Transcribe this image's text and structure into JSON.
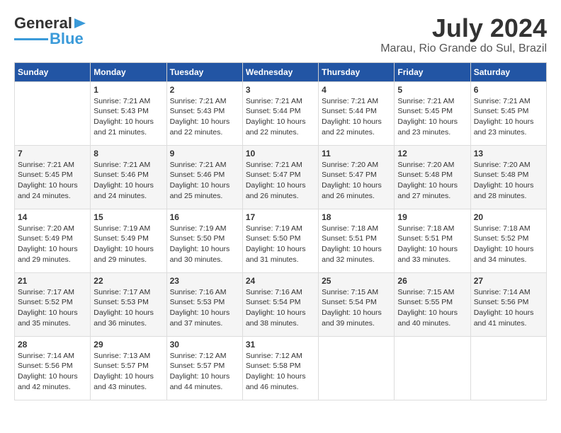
{
  "header": {
    "logo_general": "General",
    "logo_blue": "Blue",
    "title": "July 2024",
    "subtitle": "Marau, Rio Grande do Sul, Brazil"
  },
  "days_of_week": [
    "Sunday",
    "Monday",
    "Tuesday",
    "Wednesday",
    "Thursday",
    "Friday",
    "Saturday"
  ],
  "weeks": [
    [
      {
        "day": "",
        "info": ""
      },
      {
        "day": "1",
        "info": "Sunrise: 7:21 AM\nSunset: 5:43 PM\nDaylight: 10 hours\nand 21 minutes."
      },
      {
        "day": "2",
        "info": "Sunrise: 7:21 AM\nSunset: 5:43 PM\nDaylight: 10 hours\nand 22 minutes."
      },
      {
        "day": "3",
        "info": "Sunrise: 7:21 AM\nSunset: 5:44 PM\nDaylight: 10 hours\nand 22 minutes."
      },
      {
        "day": "4",
        "info": "Sunrise: 7:21 AM\nSunset: 5:44 PM\nDaylight: 10 hours\nand 22 minutes."
      },
      {
        "day": "5",
        "info": "Sunrise: 7:21 AM\nSunset: 5:45 PM\nDaylight: 10 hours\nand 23 minutes."
      },
      {
        "day": "6",
        "info": "Sunrise: 7:21 AM\nSunset: 5:45 PM\nDaylight: 10 hours\nand 23 minutes."
      }
    ],
    [
      {
        "day": "7",
        "info": "Sunrise: 7:21 AM\nSunset: 5:45 PM\nDaylight: 10 hours\nand 24 minutes."
      },
      {
        "day": "8",
        "info": "Sunrise: 7:21 AM\nSunset: 5:46 PM\nDaylight: 10 hours\nand 24 minutes."
      },
      {
        "day": "9",
        "info": "Sunrise: 7:21 AM\nSunset: 5:46 PM\nDaylight: 10 hours\nand 25 minutes."
      },
      {
        "day": "10",
        "info": "Sunrise: 7:21 AM\nSunset: 5:47 PM\nDaylight: 10 hours\nand 26 minutes."
      },
      {
        "day": "11",
        "info": "Sunrise: 7:20 AM\nSunset: 5:47 PM\nDaylight: 10 hours\nand 26 minutes."
      },
      {
        "day": "12",
        "info": "Sunrise: 7:20 AM\nSunset: 5:48 PM\nDaylight: 10 hours\nand 27 minutes."
      },
      {
        "day": "13",
        "info": "Sunrise: 7:20 AM\nSunset: 5:48 PM\nDaylight: 10 hours\nand 28 minutes."
      }
    ],
    [
      {
        "day": "14",
        "info": "Sunrise: 7:20 AM\nSunset: 5:49 PM\nDaylight: 10 hours\nand 29 minutes."
      },
      {
        "day": "15",
        "info": "Sunrise: 7:19 AM\nSunset: 5:49 PM\nDaylight: 10 hours\nand 29 minutes."
      },
      {
        "day": "16",
        "info": "Sunrise: 7:19 AM\nSunset: 5:50 PM\nDaylight: 10 hours\nand 30 minutes."
      },
      {
        "day": "17",
        "info": "Sunrise: 7:19 AM\nSunset: 5:50 PM\nDaylight: 10 hours\nand 31 minutes."
      },
      {
        "day": "18",
        "info": "Sunrise: 7:18 AM\nSunset: 5:51 PM\nDaylight: 10 hours\nand 32 minutes."
      },
      {
        "day": "19",
        "info": "Sunrise: 7:18 AM\nSunset: 5:51 PM\nDaylight: 10 hours\nand 33 minutes."
      },
      {
        "day": "20",
        "info": "Sunrise: 7:18 AM\nSunset: 5:52 PM\nDaylight: 10 hours\nand 34 minutes."
      }
    ],
    [
      {
        "day": "21",
        "info": "Sunrise: 7:17 AM\nSunset: 5:52 PM\nDaylight: 10 hours\nand 35 minutes."
      },
      {
        "day": "22",
        "info": "Sunrise: 7:17 AM\nSunset: 5:53 PM\nDaylight: 10 hours\nand 36 minutes."
      },
      {
        "day": "23",
        "info": "Sunrise: 7:16 AM\nSunset: 5:53 PM\nDaylight: 10 hours\nand 37 minutes."
      },
      {
        "day": "24",
        "info": "Sunrise: 7:16 AM\nSunset: 5:54 PM\nDaylight: 10 hours\nand 38 minutes."
      },
      {
        "day": "25",
        "info": "Sunrise: 7:15 AM\nSunset: 5:54 PM\nDaylight: 10 hours\nand 39 minutes."
      },
      {
        "day": "26",
        "info": "Sunrise: 7:15 AM\nSunset: 5:55 PM\nDaylight: 10 hours\nand 40 minutes."
      },
      {
        "day": "27",
        "info": "Sunrise: 7:14 AM\nSunset: 5:56 PM\nDaylight: 10 hours\nand 41 minutes."
      }
    ],
    [
      {
        "day": "28",
        "info": "Sunrise: 7:14 AM\nSunset: 5:56 PM\nDaylight: 10 hours\nand 42 minutes."
      },
      {
        "day": "29",
        "info": "Sunrise: 7:13 AM\nSunset: 5:57 PM\nDaylight: 10 hours\nand 43 minutes."
      },
      {
        "day": "30",
        "info": "Sunrise: 7:12 AM\nSunset: 5:57 PM\nDaylight: 10 hours\nand 44 minutes."
      },
      {
        "day": "31",
        "info": "Sunrise: 7:12 AM\nSunset: 5:58 PM\nDaylight: 10 hours\nand 46 minutes."
      },
      {
        "day": "",
        "info": ""
      },
      {
        "day": "",
        "info": ""
      },
      {
        "day": "",
        "info": ""
      }
    ]
  ]
}
